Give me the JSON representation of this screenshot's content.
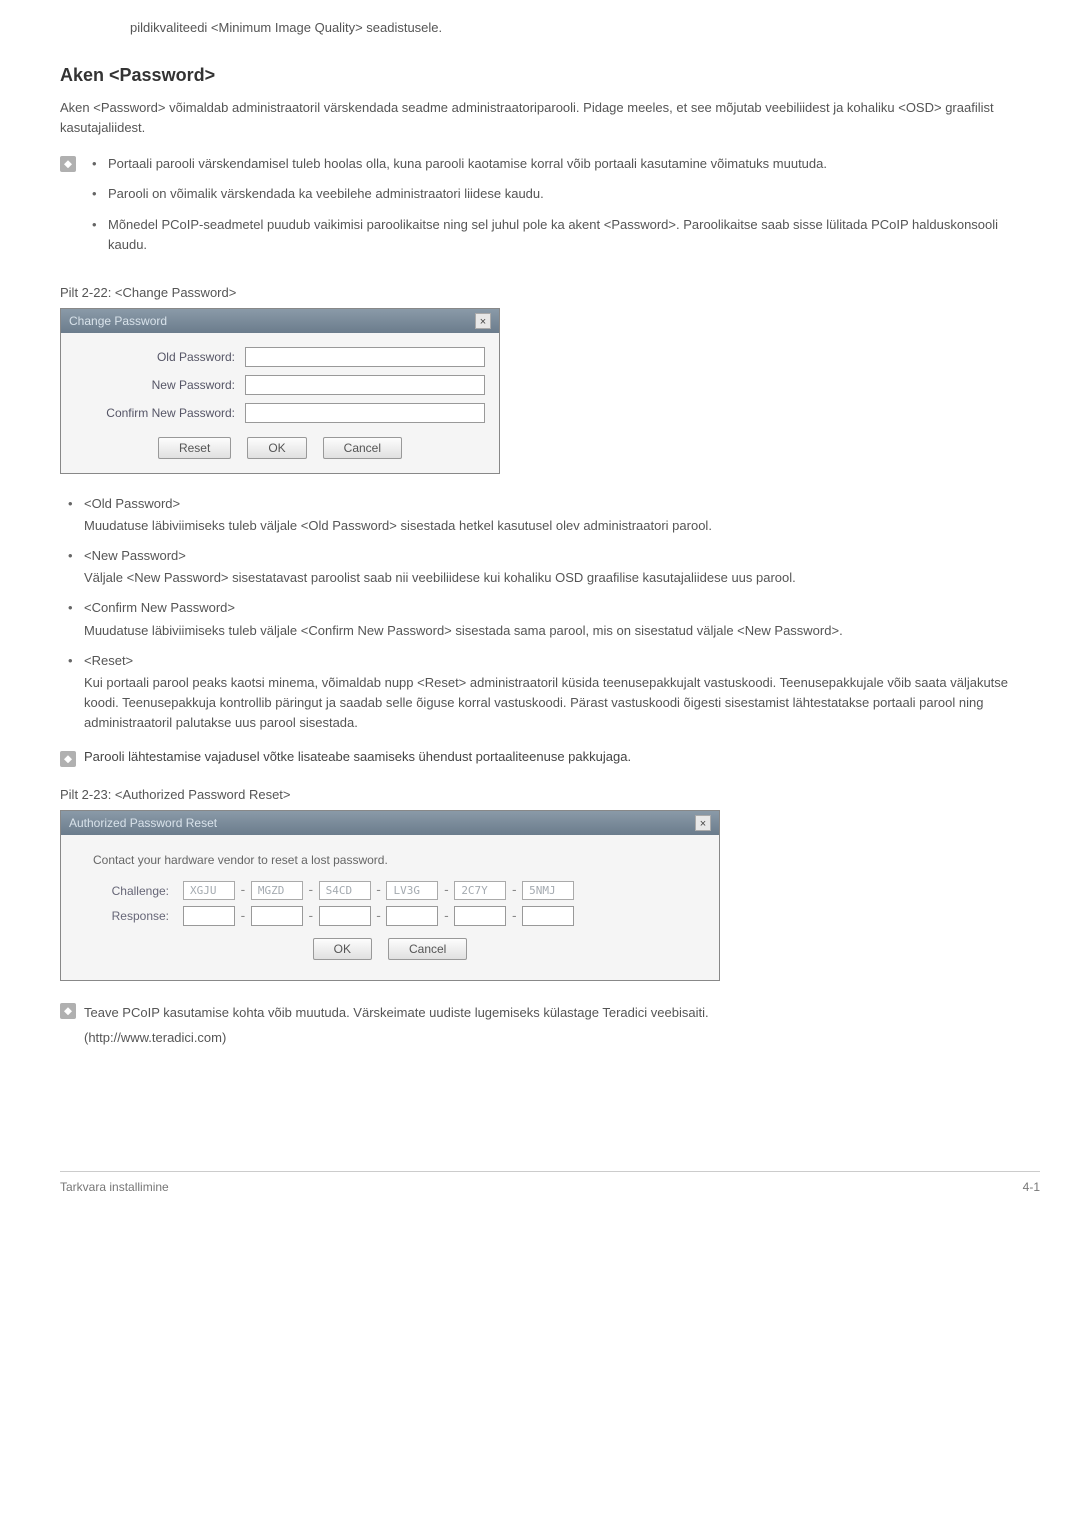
{
  "top_note": "pildikvaliteedi <Minimum Image Quality> seadistusele.",
  "heading": "Aken <Password>",
  "intro": "Aken <Password> võimaldab administraatoril värskendada seadme administraatoriparooli. Pidage meeles, et see mõjutab veebiliidest ja kohaliku <OSD> graafilist kasutajaliidest.",
  "note_bullets": [
    "Portaali parooli värskendamisel tuleb hoolas olla, kuna parooli kaotamise korral võib portaali kasutamine võimatuks muutuda.",
    "Parooli on võimalik värskendada ka veebilehe administraatori liidese kaudu.",
    "Mõnedel PCoIP-seadmetel puudub vaikimisi paroolikaitse ning sel juhul pole ka akent <Password>. Paroolikaitse saab sisse lülitada PCoIP halduskonsooli kaudu."
  ],
  "fig1_caption": "Pilt 2-22: <Change Password>",
  "dialog1": {
    "title": "Change Password",
    "labels": {
      "old": "Old Password:",
      "new": "New Password:",
      "confirm": "Confirm New Password:"
    },
    "buttons": {
      "reset": "Reset",
      "ok": "OK",
      "cancel": "Cancel"
    }
  },
  "defs": [
    {
      "term": "<Old Password>",
      "desc": "Muudatuse läbiviimiseks tuleb väljale <Old Password> sisestada hetkel kasutusel olev administraatori parool."
    },
    {
      "term": "<New Password>",
      "desc": "Väljale <New Password> sisestatavast paroolist saab nii veebiliidese kui kohaliku OSD graafilise kasutajaliidese uus parool."
    },
    {
      "term": "<Confirm New Password>",
      "desc": "Muudatuse läbiviimiseks tuleb väljale <Confirm New Password> sisestada sama parool, mis on sisestatud väljale <New Password>."
    },
    {
      "term": "<Reset>",
      "desc": "Kui portaali parool peaks kaotsi minema, võimaldab nupp <Reset> administraatoril küsida teenusepakkujalt vastuskoodi. Teenusepakkujale võib saata väljakutse koodi. Teenusepakkuja kontrollib päringut ja saadab selle õiguse korral vastuskoodi. Pärast vastuskoodi õigesti sisestamist lähtestatakse portaali parool ning administraatoril palutakse uus parool sisestada."
    }
  ],
  "inline_note": "Parooli lähtestamise vajadusel võtke lisateabe saamiseks ühendust portaaliteenuse pakkujaga.",
  "fig2_caption": "Pilt 2-23: <Authorized Password Reset>",
  "dialog2": {
    "title": "Authorized Password Reset",
    "contact": "Contact your hardware vendor to reset a lost password.",
    "challenge_label": "Challenge:",
    "response_label": "Response:",
    "segments": [
      "XGJU",
      "MGZD",
      "S4CD",
      "LV3G",
      "2C7Y",
      "5NMJ"
    ],
    "buttons": {
      "ok": "OK",
      "cancel": "Cancel"
    }
  },
  "final_note_line1": "Teave PCoIP kasutamise kohta võib muutuda. Värskeimate uudiste lugemiseks külastage Teradici veebisaiti.",
  "final_note_line2": "(http://www.teradici.com)",
  "footer": {
    "left": "Tarkvara installimine",
    "right": "4-1"
  }
}
